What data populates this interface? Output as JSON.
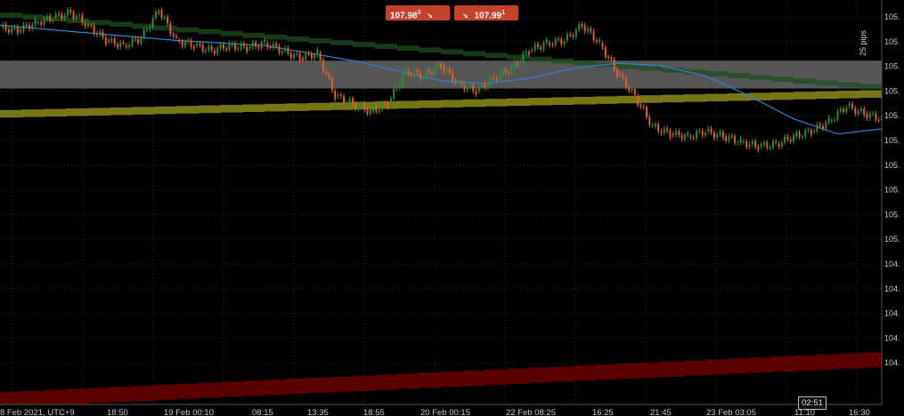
{
  "quotes": {
    "sell": {
      "price": "107.98",
      "pip": "3",
      "arrow": "↘"
    },
    "buy": {
      "price": "107.99",
      "pip": "1",
      "arrow": "↘"
    }
  },
  "pips_label": "25 pips",
  "cursor_time": "02:51",
  "colors": {
    "background": "#000000",
    "grid": "#2a2a2a",
    "candle_up": "#2e8b3a",
    "candle_down": "#d9622b",
    "ma_line": "#2f7fd6",
    "gray_zone": "#6e6e6e",
    "yellow_band": "#8b8b1a",
    "red_band": "#6b0000",
    "green_band": "#1f4d1f",
    "trend_arrow": "#ff5a2a"
  },
  "chart_data": {
    "type": "line",
    "title": "",
    "xlabel": "",
    "ylabel": "",
    "price_axis_labels": [
      "105.",
      "105.",
      "105.",
      "105.",
      "105.",
      "105.",
      "105.",
      "105.",
      "105.",
      "105.",
      "104.",
      "104.",
      "104.",
      "104.",
      "104."
    ],
    "time_labels": [
      "8 Feb 2021, UTC+9",
      "18:50",
      "19 Feb 00:10",
      "08:15",
      "13:35",
      "18:55",
      "20 Feb 00:15",
      "22 Feb 08:25",
      "16:25",
      "21:45",
      "23 Feb 03:05",
      "11:10",
      "16:30"
    ],
    "ylim": [
      104.0,
      105.6
    ],
    "series": [
      {
        "kind": "price",
        "x": [
          0,
          0.02,
          0.04,
          0.06,
          0.08,
          0.1,
          0.12,
          0.14,
          0.16,
          0.18,
          0.2,
          0.22,
          0.24,
          0.26,
          0.28,
          0.3,
          0.32,
          0.34,
          0.36,
          0.38,
          0.4,
          0.42,
          0.44,
          0.46,
          0.48,
          0.5,
          0.52,
          0.54,
          0.56,
          0.58,
          0.6,
          0.62,
          0.64,
          0.66,
          0.68,
          0.7,
          0.72,
          0.74,
          0.76,
          0.78,
          0.8,
          0.82,
          0.84,
          0.86,
          0.88,
          0.9,
          0.92,
          0.94,
          0.96,
          0.98,
          1.0
        ],
        "y": [
          105.49,
          105.48,
          105.51,
          105.53,
          105.55,
          105.5,
          105.44,
          105.42,
          105.45,
          105.56,
          105.44,
          105.42,
          105.4,
          105.42,
          105.41,
          105.43,
          105.4,
          105.37,
          105.39,
          105.22,
          105.19,
          105.16,
          105.19,
          105.32,
          105.3,
          105.34,
          105.27,
          105.24,
          105.29,
          105.33,
          105.4,
          105.43,
          105.44,
          105.5,
          105.43,
          105.31,
          105.22,
          105.1,
          105.07,
          105.06,
          105.08,
          105.06,
          105.04,
          105.02,
          105.03,
          105.06,
          105.08,
          105.12,
          105.18,
          105.15,
          105.13
        ]
      },
      {
        "kind": "moving_average",
        "x": [
          0,
          0.1,
          0.2,
          0.3,
          0.4,
          0.45,
          0.5,
          0.55,
          0.6,
          0.65,
          0.7,
          0.75,
          0.8,
          0.85,
          0.9,
          0.95,
          1.0
        ],
        "y": [
          105.5,
          105.47,
          105.44,
          105.42,
          105.36,
          105.32,
          105.28,
          105.27,
          105.29,
          105.33,
          105.35,
          105.34,
          105.3,
          105.22,
          105.13,
          105.07,
          105.09
        ]
      }
    ],
    "zones": [
      {
        "kind": "gray",
        "x_start": 0.0,
        "x_end": 1.0,
        "y_top": 105.36,
        "y_bottom": 105.25
      },
      {
        "kind": "yellow",
        "x_start": 0.0,
        "x_end": 1.0,
        "y_start_center": 105.15,
        "y_end_center": 105.23,
        "thickness": 0.03
      },
      {
        "kind": "red",
        "x_start": 0.0,
        "x_end": 1.0,
        "y_start_center": 104.02,
        "y_end_center": 104.18,
        "thickness": 0.06
      },
      {
        "kind": "green",
        "x_start": 0.0,
        "x_end": 1.0,
        "y_start_center": 105.54,
        "y_end_center": 105.25,
        "thickness": 0.02
      }
    ],
    "grid": true
  }
}
